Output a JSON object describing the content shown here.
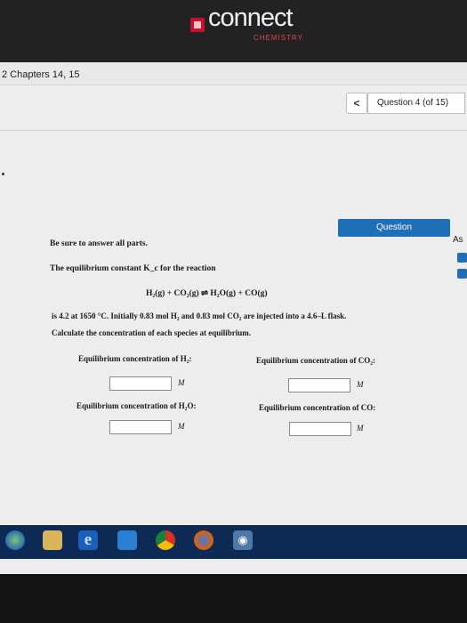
{
  "header": {
    "logo_text": "connect",
    "logo_sub": "CHEMISTRY"
  },
  "chapter": {
    "label": "2 Chapters 14, 15"
  },
  "nav": {
    "prev_glyph": "<",
    "counter": "Question 4 (of 15)"
  },
  "side_panel": {
    "tab_label": "Question",
    "as_text": "As"
  },
  "problem": {
    "intro": "Be sure to answer all parts.",
    "kc_text": "The equilibrium constant K_c for the reaction",
    "equation": "H₂(g) + CO₂(g) ⇌ H₂O(g) + CO(g)",
    "line1": "is 4.2 at 1650 °C. Initially 0.83 mol H₂ and 0.83 mol CO₂ are injected into a 4.6–L flask.",
    "line2": "Calculate the concentration of each species at equilibrium."
  },
  "answers": {
    "h2_label": "Equilibrium concentration of H₂:",
    "co2_label": "Equilibrium concentration of CO₂:",
    "h2o_label": "Equilibrium concentration of H₂O:",
    "co_label": "Equilibrium concentration of CO:",
    "unit": "M",
    "h2_value": "",
    "co2_value": "",
    "h2o_value": "",
    "co_value": ""
  },
  "taskbar": {
    "icons": [
      "start-icon",
      "folder-icon",
      "internet-explorer-icon",
      "media-player-icon",
      "chrome-icon",
      "firefox-icon",
      "network-icon"
    ]
  }
}
